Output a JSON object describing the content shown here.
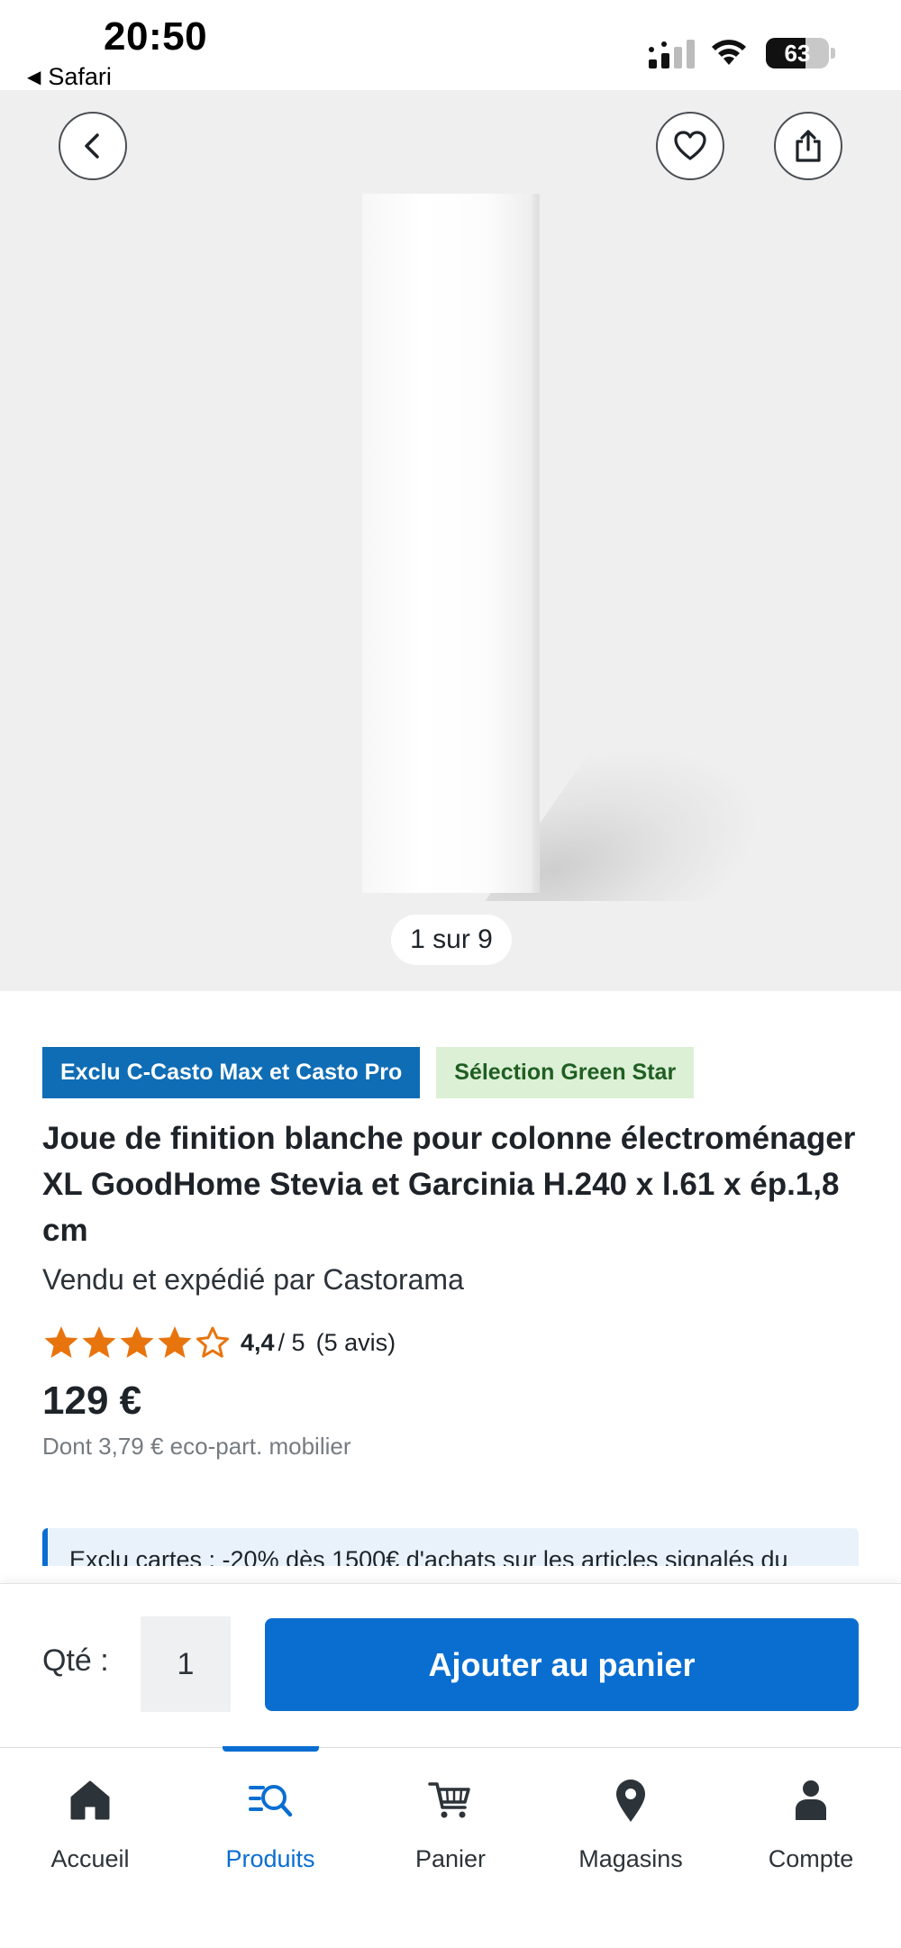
{
  "status_bar": {
    "time": "20:50",
    "back_app": "Safari",
    "battery_percent": "63",
    "battery_level": 0.63
  },
  "gallery": {
    "back_icon": "chevron-left-icon",
    "favorite_icon": "heart-icon",
    "share_icon": "share-icon",
    "pager": "1 sur 9"
  },
  "product": {
    "badges": [
      {
        "label": "Exclu C-Casto Max et Casto Pro",
        "color": "#0f6db5"
      },
      {
        "label": "Sélection Green Star",
        "color": "#dcf0d6"
      }
    ],
    "title": "Joue de finition blanche pour colonne électroménager XL GoodHome Stevia et Garcinia H.240 x l.61 x ép.1,8 cm",
    "seller": "Vendu et expédié par Castorama",
    "rating": {
      "value": 4.4,
      "score": "4,4",
      "out_of": "/ 5",
      "count": "(5 avis)",
      "star_color": "#e8740e"
    },
    "price": "129 €",
    "eco_part": "Dont 3,79 € eco-part. mobilier",
    "promo": "Exclu cartes : -20% dès 1500€ d'achats sur les articles signalés du"
  },
  "cart": {
    "qty_label": "Qté :",
    "qty_value": "1",
    "add_button": "Ajouter au panier",
    "accent": "#0a6ed1"
  },
  "nav": {
    "items": [
      {
        "label": "Accueil",
        "icon": "home-icon"
      },
      {
        "label": "Produits",
        "icon": "product-search-icon",
        "active": true
      },
      {
        "label": "Panier",
        "icon": "cart-icon"
      },
      {
        "label": "Magasins",
        "icon": "location-pin-icon"
      },
      {
        "label": "Compte",
        "icon": "user-icon"
      }
    ]
  }
}
